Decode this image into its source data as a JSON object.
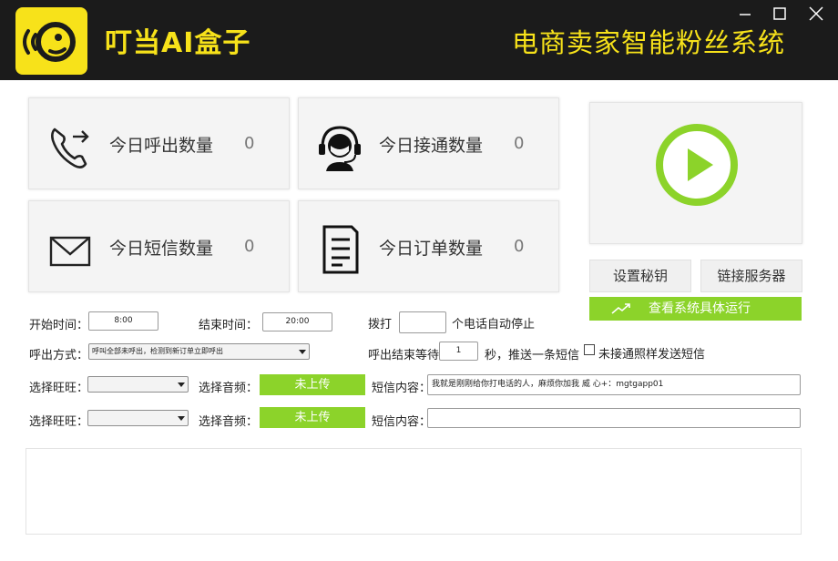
{
  "header": {
    "app_title": "叮当AI盒子",
    "slogan": "电商卖家智能粉丝系统",
    "brand_color": "#f7e21a"
  },
  "window_controls": [
    "minimize-icon",
    "maximize-icon",
    "close-icon"
  ],
  "stats": [
    {
      "label": "今日呼出数量",
      "value": "0",
      "icon": "outgoing-call-icon"
    },
    {
      "label": "今日接通数量",
      "value": "0",
      "icon": "headset-agent-icon"
    },
    {
      "label": "今日短信数量",
      "value": "0",
      "icon": "envelope-icon"
    },
    {
      "label": "今日订单数量",
      "value": "0",
      "icon": "document-icon"
    }
  ],
  "play": {
    "icon": "play-icon",
    "accent": "#8cd32a"
  },
  "buttons": {
    "set_key": "设置秘钥",
    "link_server": "链接服务器",
    "view_run": "查看系统具体运行"
  },
  "settings": {
    "start_time_label": "开始时间：",
    "start_time_value": "8:00",
    "end_time_label": "结束时间：",
    "end_time_value": "20:00",
    "dial_label": "拨打",
    "dial_value": "",
    "dial_suffix": "个电话自动停止",
    "call_mode_label": "呼出方式：",
    "call_mode_value": "呼叫全部未呼出，检测到新订单立即呼出",
    "wait_label": "呼出结束等待",
    "wait_value": "1",
    "wait_suffix": "秒，推送一条短信",
    "no_answer_label": "未接通照样发送短信",
    "rows": [
      {
        "wangwang_label": "选择旺旺：",
        "audio_label": "选择音频：",
        "upload_label": "未上传",
        "sms_label": "短信内容：",
        "sms_value": "我就是刚刚给你打电话的人，麻烦你加我 威 心+：mgtgapp01"
      },
      {
        "wangwang_label": "选择旺旺：",
        "audio_label": "选择音频：",
        "upload_label": "未上传",
        "sms_label": "短信内容：",
        "sms_value": ""
      }
    ]
  }
}
